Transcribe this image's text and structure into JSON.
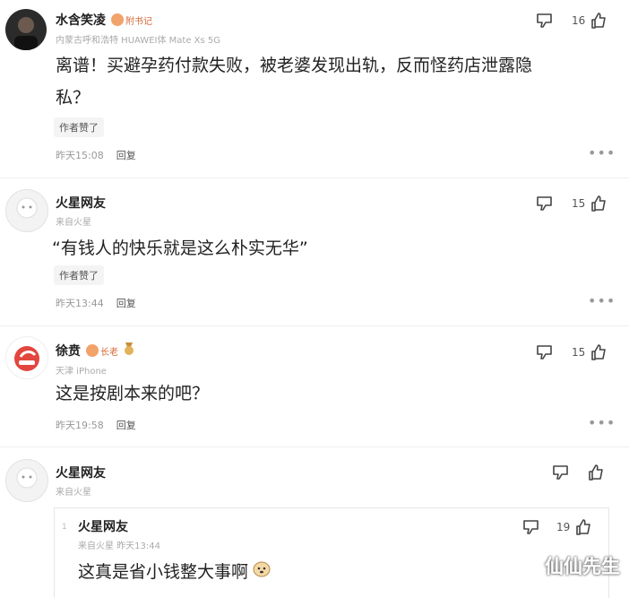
{
  "comments": [
    {
      "username": "水含笑凌",
      "badge": "附书记",
      "meta": "内蒙古呼和浩特  HUAWEI体 Mate Xs 5G",
      "text_line1": "离谱！买避孕药付款失败，被老婆发现出轨，反而怪药店泄露隐",
      "text_line2": "私？",
      "chip": "作者赞了",
      "time": "昨天15:08",
      "reply": "回复",
      "likes": "16"
    },
    {
      "username": "火星网友",
      "meta": "来自火星",
      "text_line1": "“有钱人的快乐就是这么朴实无华”",
      "chip": "作者赞了",
      "time": "昨天13:44",
      "reply": "回复",
      "likes": "15"
    },
    {
      "username": "徐贲",
      "badge": "长老",
      "meta": "天津  iPhone",
      "text_line1": "这是按剧本来的吧？",
      "time": "昨天19:58",
      "reply": "回复",
      "likes": "15"
    },
    {
      "username": "火星网友",
      "meta": "来自火星",
      "likes": ""
    }
  ],
  "nested_reply": {
    "index": "1",
    "username": "火星网友",
    "meta": "来自火星  昨天13:44",
    "text": "这真是省小钱整大事啊",
    "likes": "19"
  },
  "watermark": "仙仙先生"
}
